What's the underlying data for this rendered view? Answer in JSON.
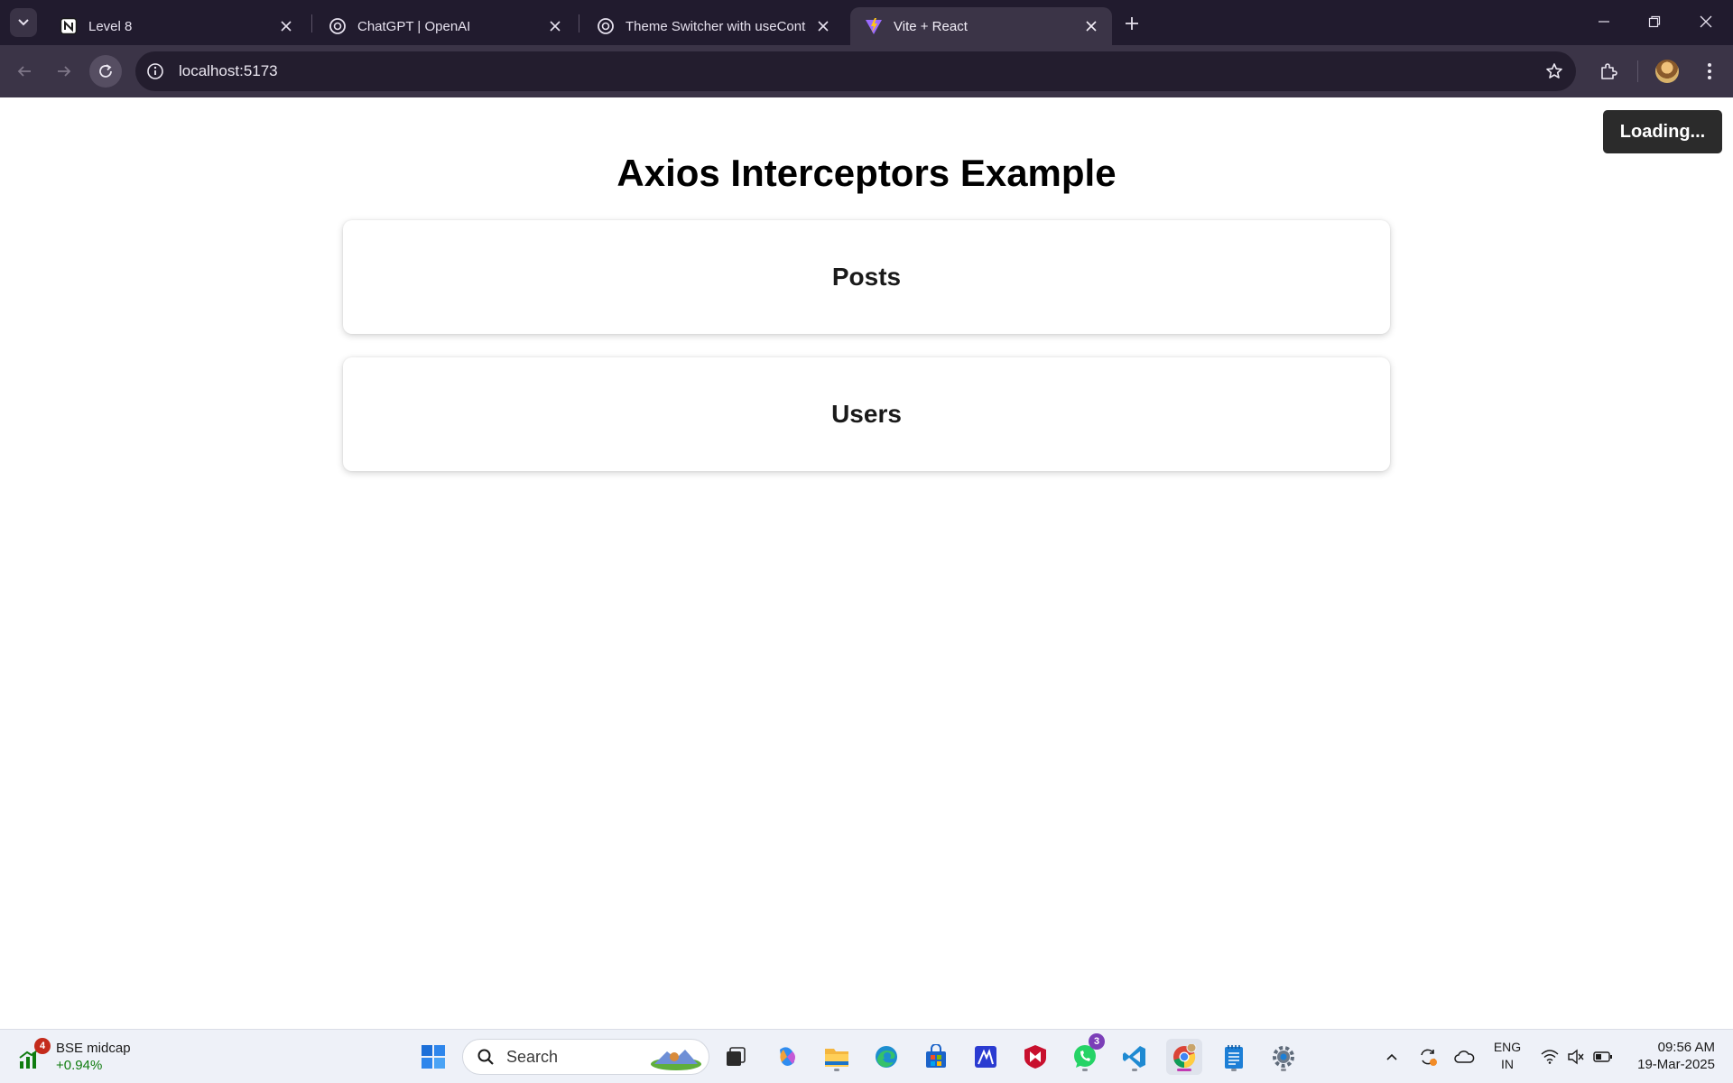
{
  "browser": {
    "tabs": [
      {
        "title": "Level 8",
        "icon": "notion-icon",
        "active": false
      },
      {
        "title": "ChatGPT | OpenAI",
        "icon": "openai-icon",
        "active": false
      },
      {
        "title": "Theme Switcher with useContext",
        "icon": "openai-icon",
        "active": false
      },
      {
        "title": "Vite + React",
        "icon": "vite-icon",
        "active": true
      }
    ],
    "url": "localhost:5173"
  },
  "page": {
    "loading_label": "Loading...",
    "title": "Axios Interceptors Example",
    "cards": [
      {
        "heading": "Posts"
      },
      {
        "heading": "Users"
      }
    ]
  },
  "taskbar": {
    "widget": {
      "name": "BSE midcap",
      "change": "+0.94%",
      "badge": "4"
    },
    "search_label": "Search",
    "apps": [
      {
        "name": "windows-start-icon"
      },
      {
        "name": "task-view-icon"
      },
      {
        "name": "copilot-icon"
      },
      {
        "name": "file-explorer-icon"
      },
      {
        "name": "edge-icon"
      },
      {
        "name": "microsoft-store-icon"
      },
      {
        "name": "mcafee-antitrack-icon"
      },
      {
        "name": "mcafee-icon"
      },
      {
        "name": "whatsapp-icon",
        "badge": "3"
      },
      {
        "name": "vscode-icon"
      },
      {
        "name": "chrome-icon"
      },
      {
        "name": "notepad-icon"
      },
      {
        "name": "settings-icon"
      }
    ],
    "language": {
      "line1": "ENG",
      "line2": "IN"
    },
    "clock": {
      "time": "09:56 AM",
      "date": "19-Mar-2025"
    }
  },
  "colors": {
    "tabstrip_bg": "#211b2e",
    "toolbar_bg": "#3b3447",
    "omnibox_bg": "#231d2e",
    "loading_bg": "#2b2b2b",
    "taskbar_bg": "#eef1f8",
    "widget_positive": "#107c10"
  }
}
